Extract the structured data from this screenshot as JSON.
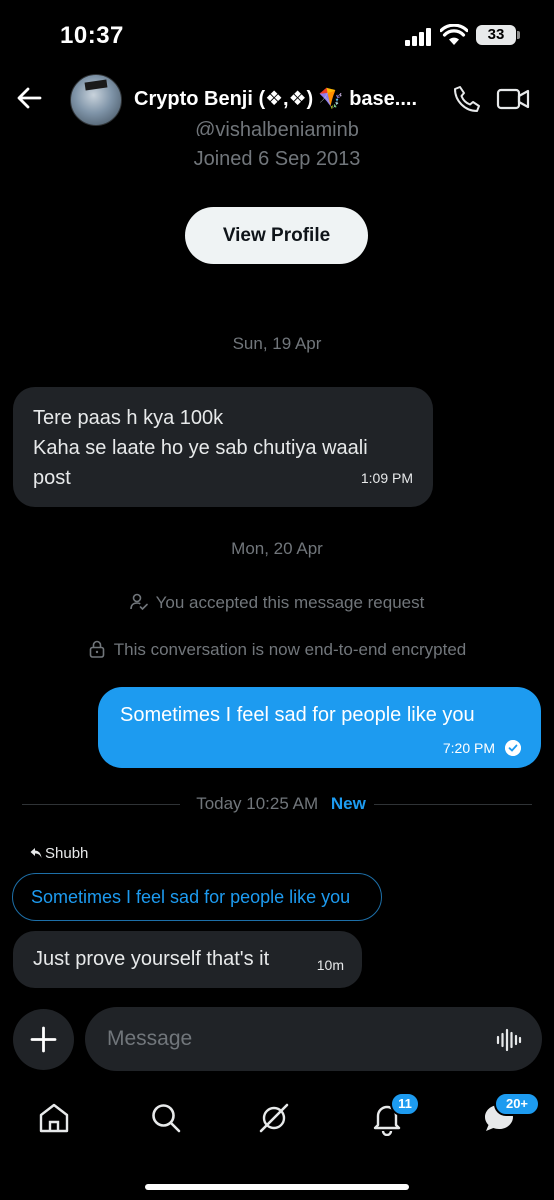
{
  "status_bar": {
    "time": "10:37",
    "battery": "33"
  },
  "header": {
    "title": "Crypto Benji (❖,❖) 🪁 base...."
  },
  "profile": {
    "handle": "@vishalbenjaminb",
    "joined": "Joined 6 Sep 2013",
    "view_profile_label": "View Profile"
  },
  "conversation": {
    "date_1": "Sun, 19 Apr",
    "message_1": {
      "lines": [
        "Tere paas h kya 100k",
        "Kaha se laate ho ye sab chutiya waali",
        "post"
      ],
      "time": "1:09 PM"
    },
    "date_2": "Mon, 20 Apr",
    "system_1": "You accepted this message request",
    "system_2": "This conversation is now end-to-end encrypted",
    "message_2": {
      "text": "Sometimes I feel sad for people like you",
      "time": "7:20 PM"
    },
    "new_separator": {
      "time": "Today 10:25 AM",
      "new_label": "New"
    },
    "reply_to": "Shubh",
    "quoted_text": "Sometimes I feel sad for people like you",
    "message_3": {
      "text": "Just prove yourself that's it",
      "time": "10m"
    }
  },
  "composer": {
    "placeholder": "Message"
  },
  "tabbar": {
    "notifications_badge": "11",
    "messages_badge": "20+"
  },
  "colors": {
    "accent": "#1d9bf0",
    "bubble_in": "#202327",
    "background": "#000000"
  }
}
